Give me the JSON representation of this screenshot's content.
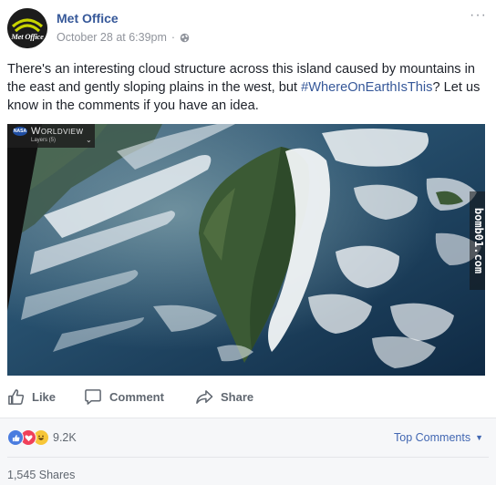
{
  "page": {
    "name": "Met Office",
    "avatar_text": "Met Office",
    "timestamp": "October 28 at 6:39pm",
    "separator": "·",
    "privacy_icon": "globe-icon",
    "more_icon": "more-options-icon",
    "more_glyph": "···"
  },
  "post": {
    "text_before": "There's an interesting cloud structure across this island caused by mountains in the east and gently sloping plains in the west, but ",
    "hashtag": "#WhereOnEarthIsThis",
    "text_after": "? Let us know in the comments if you have an idea."
  },
  "photo": {
    "badge": "NASA",
    "app_label": "Worldview",
    "layers_label": "Layers (5)",
    "chevron": "⌄",
    "watermark": "bomb01.com"
  },
  "actions": {
    "like": "Like",
    "comment": "Comment",
    "share": "Share"
  },
  "footer": {
    "reaction_count": "9.2K",
    "sort_label": "Top Comments",
    "sort_caret": "▼",
    "shares": "1,545 Shares"
  },
  "colors": {
    "link_blue": "#365899",
    "text": "#1d2129",
    "muted": "#90949c",
    "action_gray": "#606770",
    "footer_bg": "#f6f7f9"
  }
}
